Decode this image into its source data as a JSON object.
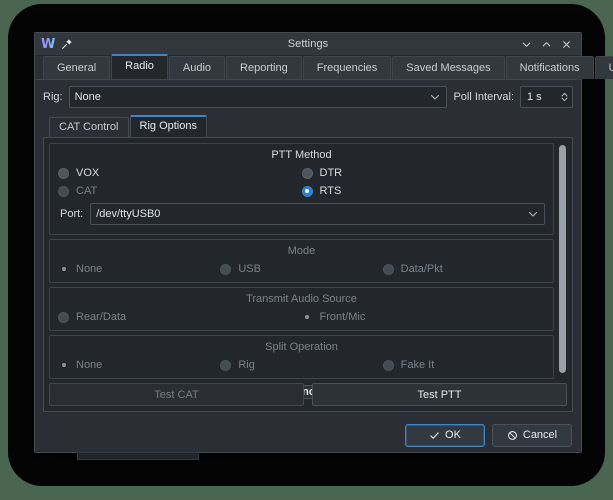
{
  "colors": {
    "accent": "#3d86c6",
    "window_bg": "#2b2f35",
    "panel_bg": "#23272c",
    "desktop": "#4a6650"
  },
  "titlebar": {
    "app_logo": "W",
    "title": "Settings",
    "pin_icon": "pin-icon",
    "minimize_icon": "chevron-down-icon",
    "maximize_icon": "chevron-up-icon",
    "close_icon": "close-icon"
  },
  "tabs": [
    {
      "label": "General",
      "selected": false
    },
    {
      "label": "Radio",
      "selected": true
    },
    {
      "label": "Audio",
      "selected": false
    },
    {
      "label": "Reporting",
      "selected": false
    },
    {
      "label": "Frequencies",
      "selected": false
    },
    {
      "label": "Saved Messages",
      "selected": false
    },
    {
      "label": "Notifications",
      "selected": false
    },
    {
      "label": "UI",
      "selected": false
    }
  ],
  "rig_row": {
    "rig_label": "Rig:",
    "rig_value": "None",
    "poll_label": "Poll Interval:",
    "poll_value": "1 s"
  },
  "subtabs": [
    {
      "label": "CAT Control",
      "selected": false
    },
    {
      "label": "Rig Options",
      "selected": true
    }
  ],
  "ptt_method": {
    "title": "PTT Method",
    "options": [
      {
        "label": "VOX",
        "checked": false,
        "disabled": false
      },
      {
        "label": "DTR",
        "checked": false,
        "disabled": false
      },
      {
        "label": "CAT",
        "checked": false,
        "disabled": true
      },
      {
        "label": "RTS",
        "checked": true,
        "disabled": false
      }
    ],
    "port_label": "Port:",
    "port_value": "/dev/ttyUSB0"
  },
  "mode": {
    "title": "Mode",
    "disabled": true,
    "options": [
      {
        "label": "None",
        "checked": true,
        "disabled": true
      },
      {
        "label": "USB",
        "checked": false,
        "disabled": true
      },
      {
        "label": "Data/Pkt",
        "checked": false,
        "disabled": true
      }
    ]
  },
  "transmit_audio": {
    "title": "Transmit Audio Source",
    "disabled": true,
    "options": [
      {
        "label": "Rear/Data",
        "checked": false,
        "disabled": true
      },
      {
        "label": "Front/Mic",
        "checked": true,
        "disabled": true
      }
    ]
  },
  "split_operation": {
    "title": "Split Operation",
    "disabled": true,
    "options": [
      {
        "label": "None",
        "checked": true,
        "disabled": true
      },
      {
        "label": "Rig",
        "checked": false,
        "disabled": true
      },
      {
        "label": "Fake It",
        "checked": false,
        "disabled": true
      }
    ]
  },
  "advanced_label": "Advanced",
  "test_buttons": {
    "test_cat": "Test CAT",
    "test_ptt": "Test PTT"
  },
  "footer": {
    "ok_label": "OK",
    "ok_icon": "check-icon",
    "cancel_label": "Cancel",
    "cancel_icon": "ban-icon"
  }
}
